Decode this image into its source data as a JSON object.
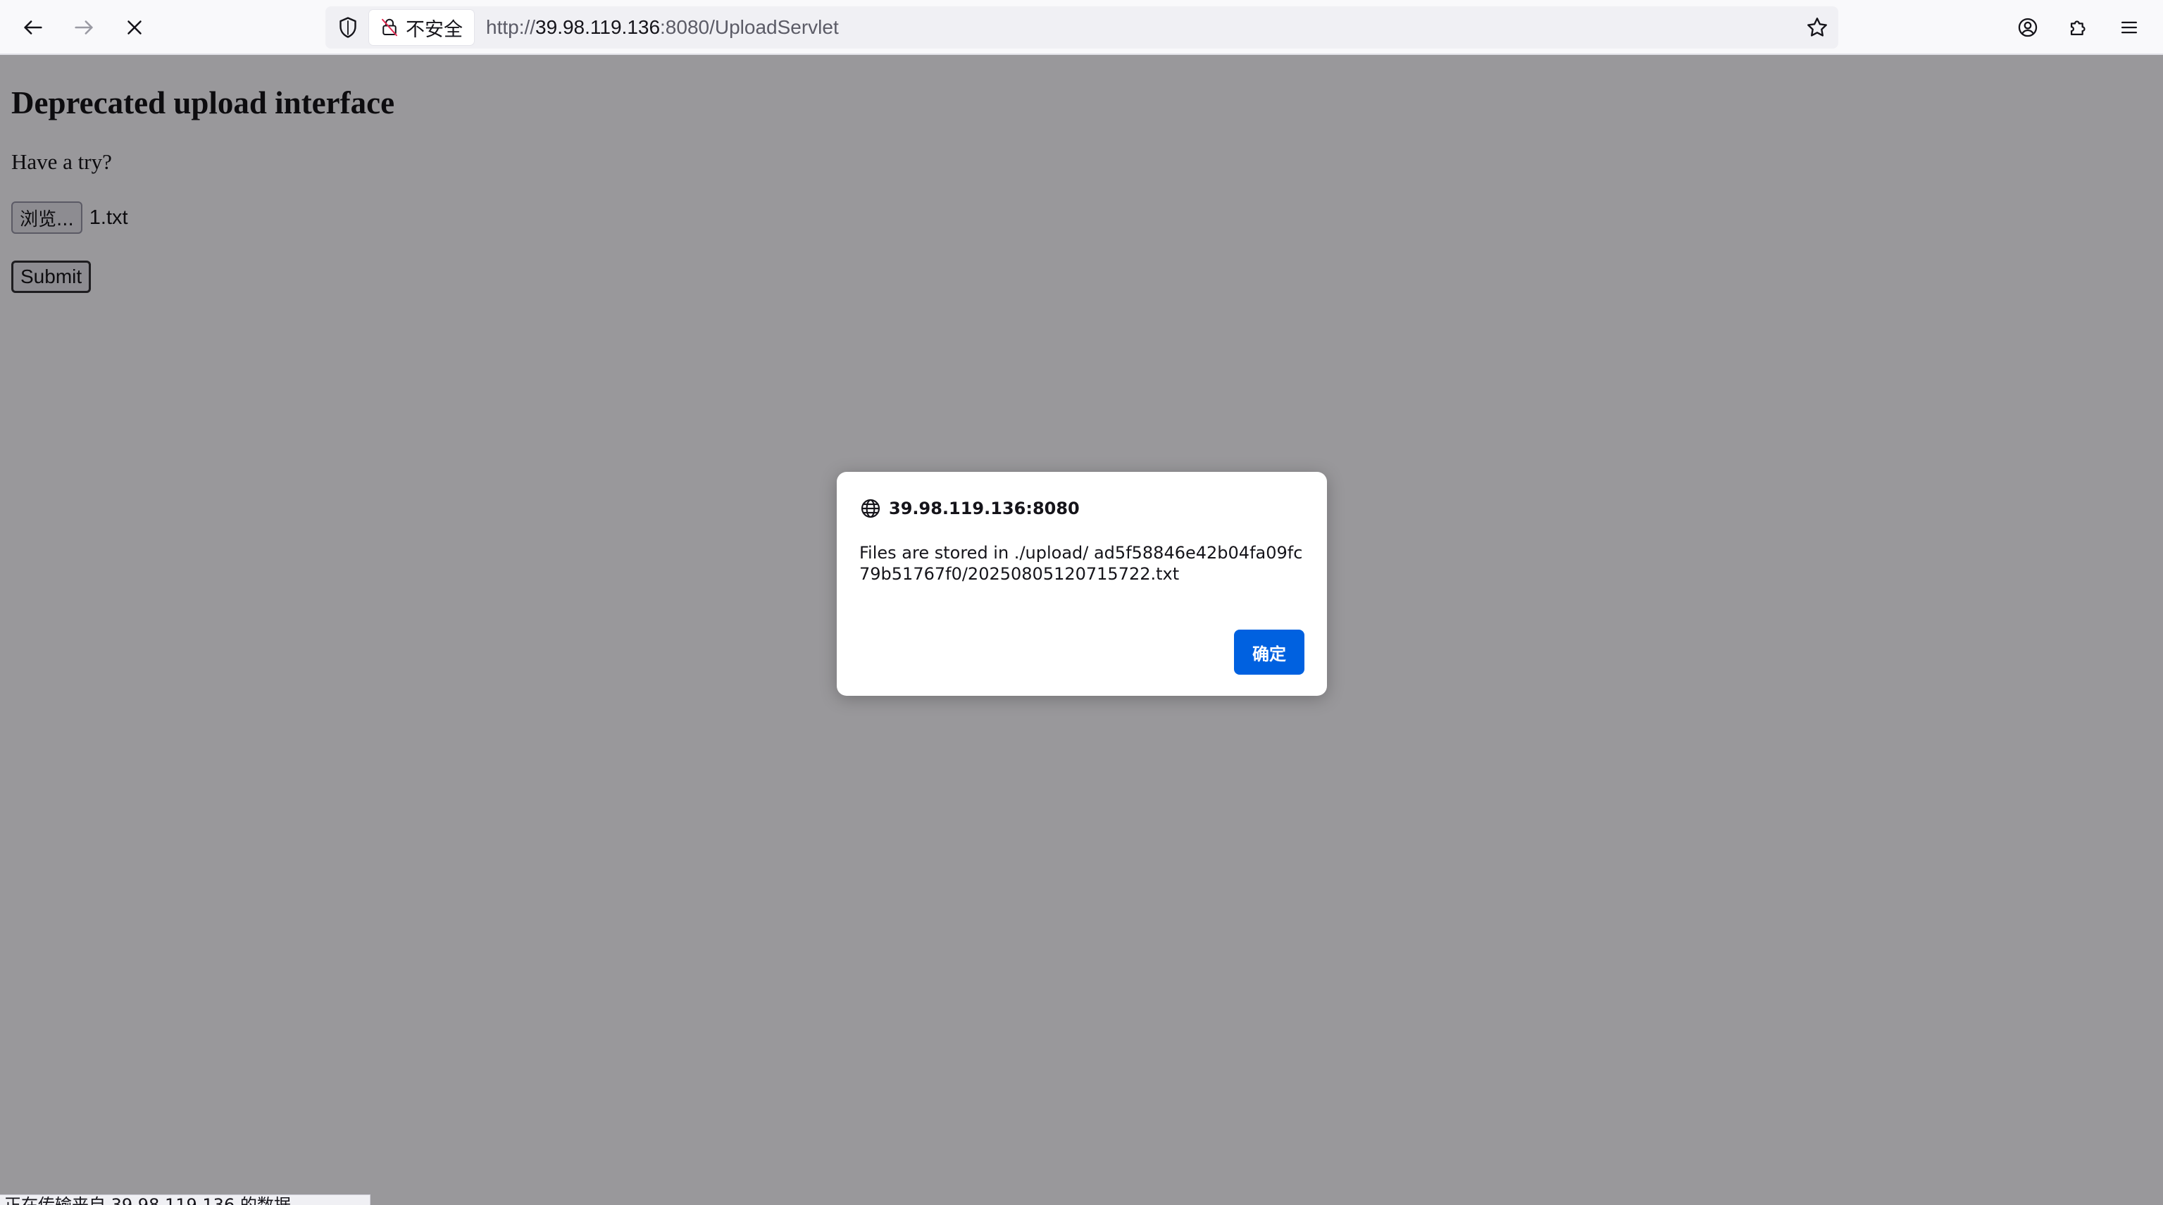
{
  "browser": {
    "url_scheme": "http://",
    "url_host": "39.98.119.136",
    "url_rest": ":8080/UploadServlet",
    "security_label": "不安全",
    "status_text": "正在传输来自 39.98.119.136 的数据…",
    "icons": {
      "back": "arrow-left-icon",
      "forward": "arrow-right-icon",
      "stop": "close-icon",
      "tracking": "shield-icon",
      "insecure": "broken-lock-icon",
      "bookmark": "star-icon",
      "account": "account-icon",
      "extensions": "puzzle-icon",
      "menu": "hamburger-menu-icon"
    }
  },
  "page": {
    "heading": "Deprecated upload interface",
    "prompt": "Have a try?",
    "browse_label": "浏览...",
    "file_name": "1.txt",
    "submit_label": "Submit"
  },
  "dialog": {
    "origin": "39.98.119.136:8080",
    "message": "Files are stored in ./upload/ ad5f58846e42b04fa09fc79b51767f0/20250805120715722.txt",
    "ok_label": "确定",
    "icon": "globe-icon",
    "accent_color": "#0061e0"
  }
}
